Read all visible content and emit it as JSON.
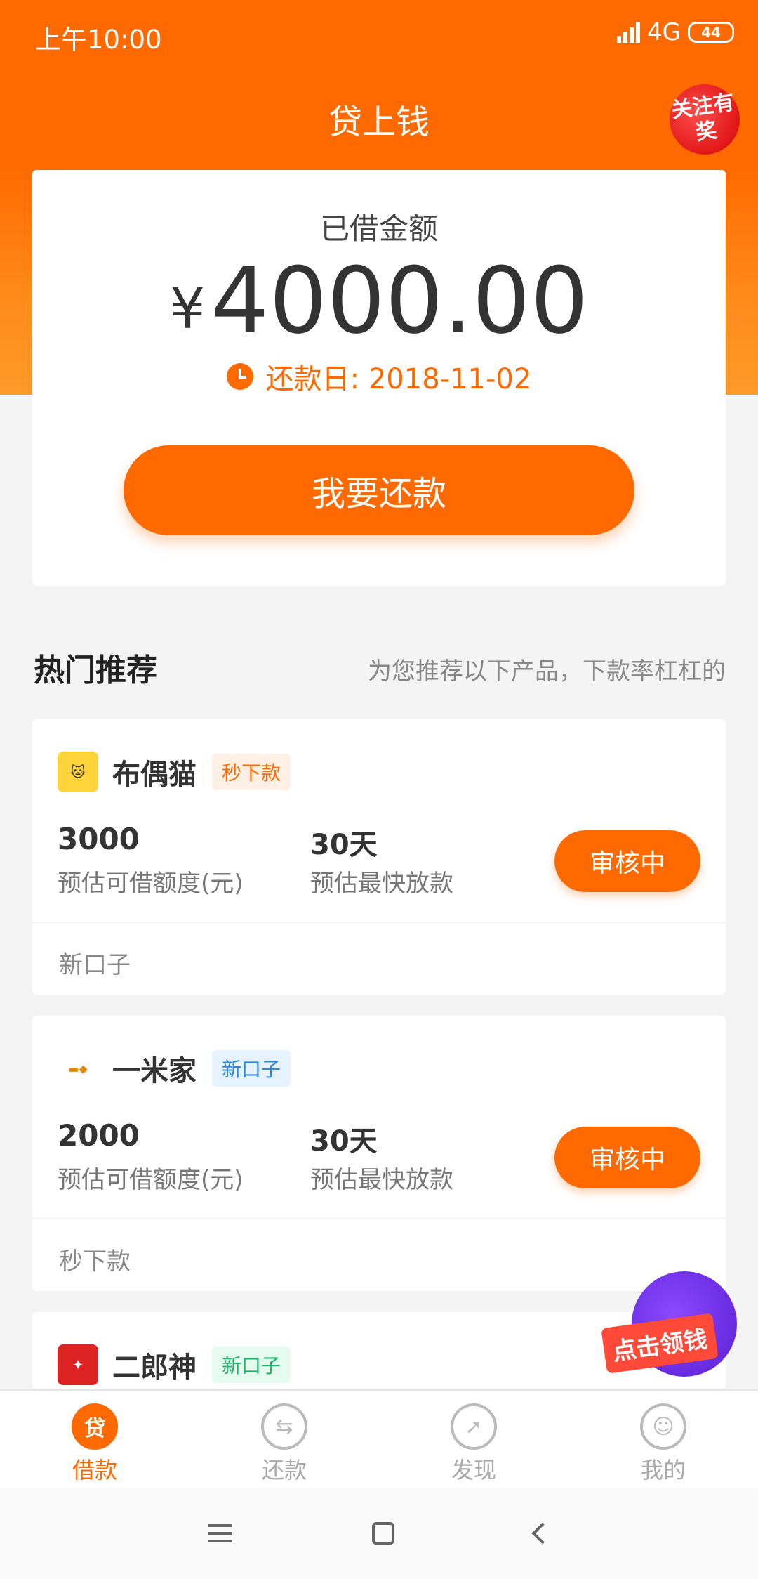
{
  "status_bar": {
    "time": "上午10:00",
    "network": "4G",
    "battery": "44"
  },
  "header": {
    "title": "贷上钱",
    "follow_badge": "关注有奖"
  },
  "loan": {
    "label": "已借金额",
    "currency": "¥",
    "amount": "4000.00",
    "due_date": "还款日: 2018-11-02",
    "repay_button": "我要还款"
  },
  "section": {
    "title": "热门推荐",
    "subtitle": "为您推荐以下产品，下款率杠杠的"
  },
  "products": [
    {
      "name": "布偶猫",
      "tag": "秒下款",
      "amount": "3000",
      "amount_label": "预估可借额度(元)",
      "days": "30天",
      "days_label": "预估最快放款",
      "button": "审核中",
      "footer": "新口子"
    },
    {
      "name": "一米家",
      "tag": "新口子",
      "amount": "2000",
      "amount_label": "预估可借额度(元)",
      "days": "30天",
      "days_label": "预估最快放款",
      "button": "审核中",
      "footer": "秒下款"
    },
    {
      "name": "二郎神",
      "tag": "新口子"
    }
  ],
  "promo": {
    "label": "点击领钱"
  },
  "bottom_nav": [
    {
      "label": "借款",
      "icon": "loan-icon",
      "glyph": "贷"
    },
    {
      "label": "还款",
      "icon": "repay-icon",
      "glyph": "⇆"
    },
    {
      "label": "发现",
      "icon": "compass-icon",
      "glyph": "➚"
    },
    {
      "label": "我的",
      "icon": "user-icon",
      "glyph": "☺"
    }
  ],
  "colors": {
    "brand": "#ff6a00",
    "tag_orange_bg": "#fff0e6",
    "tag_blue_bg": "#e6f2ff",
    "tag_green_bg": "#e6fbef"
  }
}
